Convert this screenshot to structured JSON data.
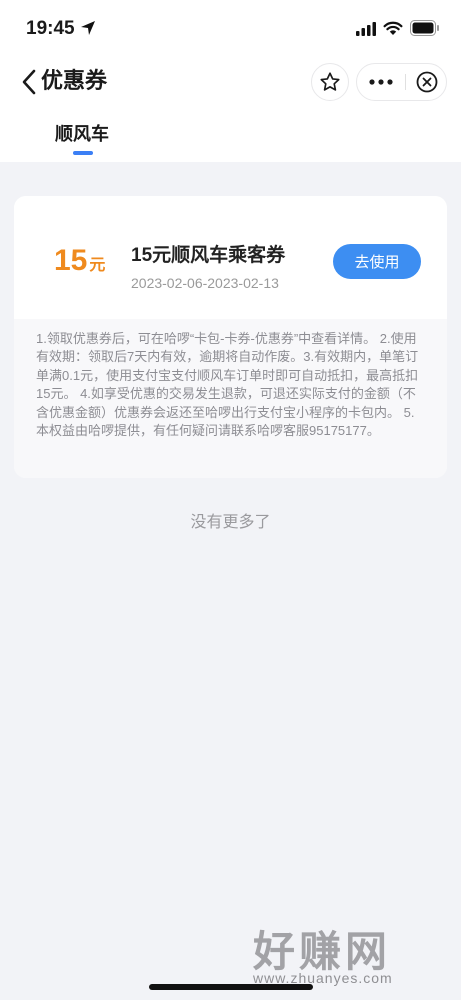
{
  "status_bar": {
    "time": "19:45"
  },
  "nav": {
    "title": "优惠券"
  },
  "tabs": [
    {
      "label": "顺风车",
      "active": true
    }
  ],
  "coupon": {
    "amount": "15",
    "unit": "元",
    "name": "15元顺风车乘客券",
    "validity": "2023-02-06-2023-02-13",
    "use_button": "去使用",
    "rules": "1.领取优惠券后，可在哈啰“卡包-卡券-优惠券”中查看详情。 2.使用有效期：领取后7天内有效，逾期将自动作废。3.有效期内，单笔订单满0.1元，使用支付宝支付顺风车订单时即可自动抵扣，最高抵扣15元。 4.如享受优惠的交易发生退款，可退还实际支付的金额（不含优惠金额）优惠券会返还至哈啰出行支付宝小程序的卡包内。 5.本权益由哈啰提供，有任何疑问请联系哈啰客服95175177。"
  },
  "footer": {
    "no_more": "没有更多了"
  },
  "watermark": {
    "brand": "好赚网",
    "url": "www.zhuanyes.com"
  },
  "colors": {
    "accent": "#3d8ef2",
    "amount": "#ef8a1e",
    "page_bg": "#f2f3f7"
  }
}
